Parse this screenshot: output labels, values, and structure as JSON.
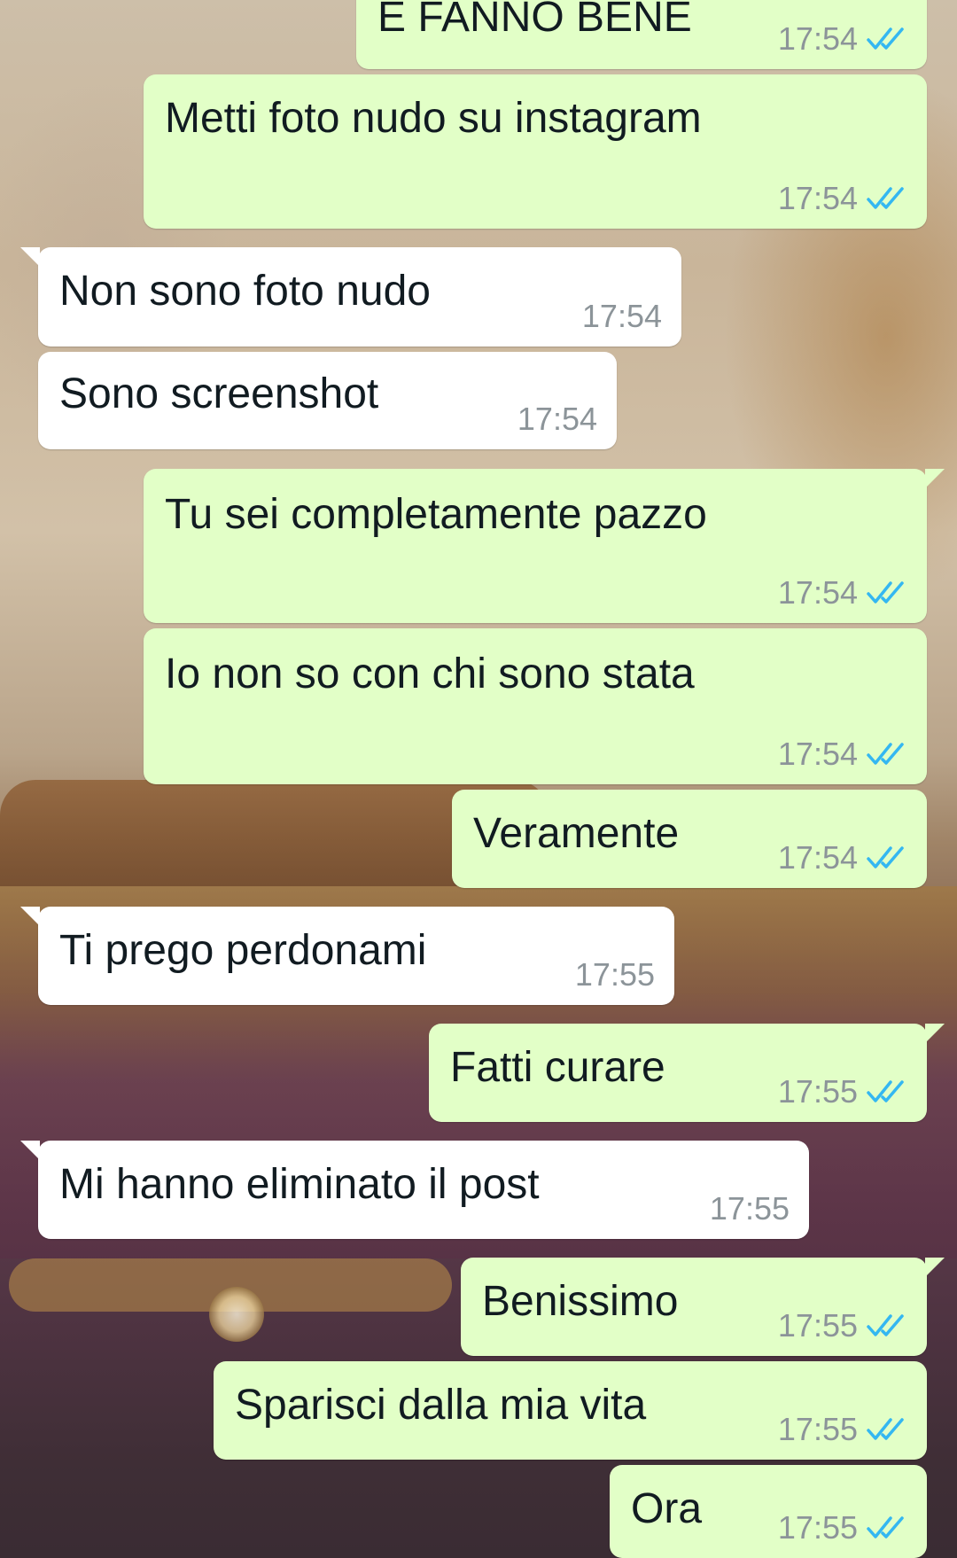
{
  "colors": {
    "outgoing_bubble": "#e2ffc7",
    "incoming_bubble": "#ffffff",
    "text": "#111b21",
    "timestamp": "#8c9499",
    "read_ticks": "#34b7f1"
  },
  "messages": [
    {
      "direction": "out",
      "text": "E FANNO BENE",
      "time": "17:54",
      "status": "read"
    },
    {
      "direction": "out",
      "text": "Metti foto nudo su instagram",
      "time": "17:54",
      "status": "read"
    },
    {
      "direction": "in",
      "text": "Non sono foto nudo",
      "time": "17:54"
    },
    {
      "direction": "in",
      "text": "Sono screenshot",
      "time": "17:54"
    },
    {
      "direction": "out",
      "text": "Tu sei completamente pazzo",
      "time": "17:54",
      "status": "read"
    },
    {
      "direction": "out",
      "text": "Io non so con chi sono stata",
      "time": "17:54",
      "status": "read"
    },
    {
      "direction": "out",
      "text": "Veramente",
      "time": "17:54",
      "status": "read"
    },
    {
      "direction": "in",
      "text": "Ti prego perdonami",
      "time": "17:55"
    },
    {
      "direction": "out",
      "text": "Fatti curare",
      "time": "17:55",
      "status": "read"
    },
    {
      "direction": "in",
      "text": "Mi hanno eliminato il post",
      "time": "17:55"
    },
    {
      "direction": "out",
      "text": "Benissimo",
      "time": "17:55",
      "status": "read"
    },
    {
      "direction": "out",
      "text": "Sparisci dalla mia vita",
      "time": "17:55",
      "status": "read"
    },
    {
      "direction": "out",
      "text": "Ora",
      "time": "17:55",
      "status": "read"
    }
  ]
}
